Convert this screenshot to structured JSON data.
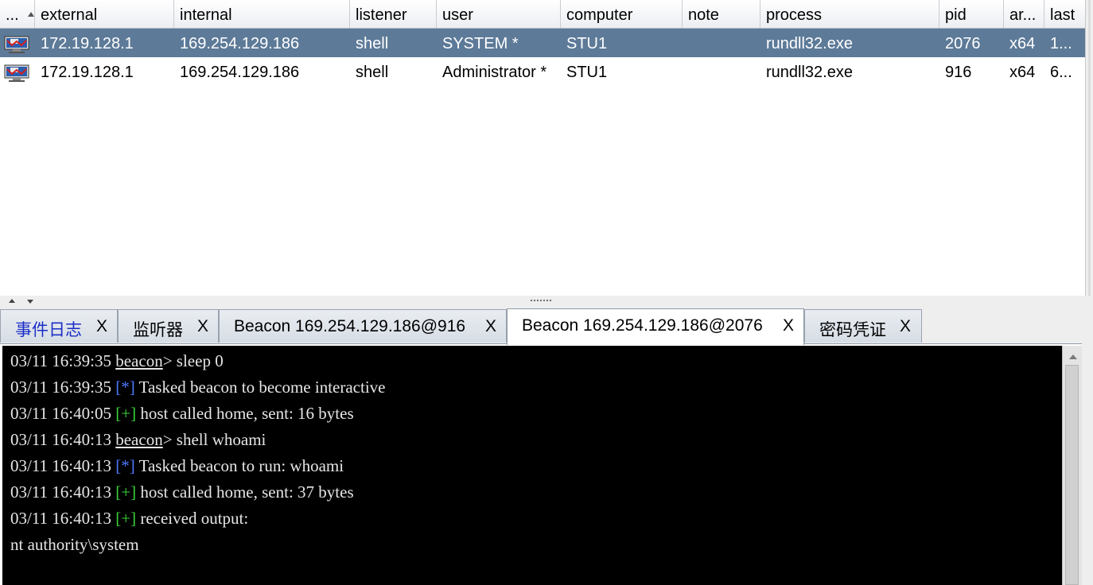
{
  "table": {
    "columns": [
      "...",
      "external",
      "internal",
      "listener",
      "user",
      "computer",
      "note",
      "process",
      "pid",
      "ar...",
      "last"
    ],
    "rows": [
      {
        "external": "172.19.128.1",
        "internal": "169.254.129.186",
        "listener": "shell",
        "user": "SYSTEM *",
        "computer": "STU1",
        "note": "",
        "process": "rundll32.exe",
        "pid": "2076",
        "arch": "x64",
        "last": "1..."
      },
      {
        "external": "172.19.128.1",
        "internal": "169.254.129.186",
        "listener": "shell",
        "user": "Administrator *",
        "computer": "STU1",
        "note": "",
        "process": "rundll32.exe",
        "pid": "916",
        "arch": "x64",
        "last": "6..."
      }
    ],
    "selected_row": 0,
    "row_icon": "beacon-session-icon"
  },
  "tabs": [
    {
      "label": "事件日志",
      "close": "X"
    },
    {
      "label": "监听器",
      "close": "X"
    },
    {
      "label": "Beacon 169.254.129.186@916",
      "close": "X"
    },
    {
      "label": "Beacon 169.254.129.186@2076",
      "close": "X"
    },
    {
      "label": "密码凭证",
      "close": "X"
    }
  ],
  "active_tab": 3,
  "console": {
    "lines": [
      {
        "ts": "03/11 16:39:35",
        "prompt": "beacon",
        "text": "> sleep 0"
      },
      {
        "ts": "03/11 16:39:35",
        "tag": "[*]",
        "text": " Tasked beacon to become interactive"
      },
      {
        "ts": "03/11 16:40:05",
        "tag": "[+]",
        "text": " host called home, sent: 16 bytes"
      },
      {
        "ts": "03/11 16:40:13",
        "prompt": "beacon",
        "text": "> shell whoami"
      },
      {
        "ts": "03/11 16:40:13",
        "tag": "[*]",
        "text": " Tasked beacon to run: whoami"
      },
      {
        "ts": "03/11 16:40:13",
        "tag": "[+]",
        "text": " host called home, sent: 37 bytes"
      },
      {
        "ts": "03/11 16:40:13",
        "tag": "[+]",
        "text": " received output:"
      },
      {
        "plain": "nt authority\\system"
      }
    ]
  },
  "colors": {
    "selected_row": "#5d7a98",
    "console_bg": "#000000",
    "info_tag": "#4f79ff",
    "ok_tag": "#39d339",
    "first_tab_text": "#1a2ec6"
  }
}
